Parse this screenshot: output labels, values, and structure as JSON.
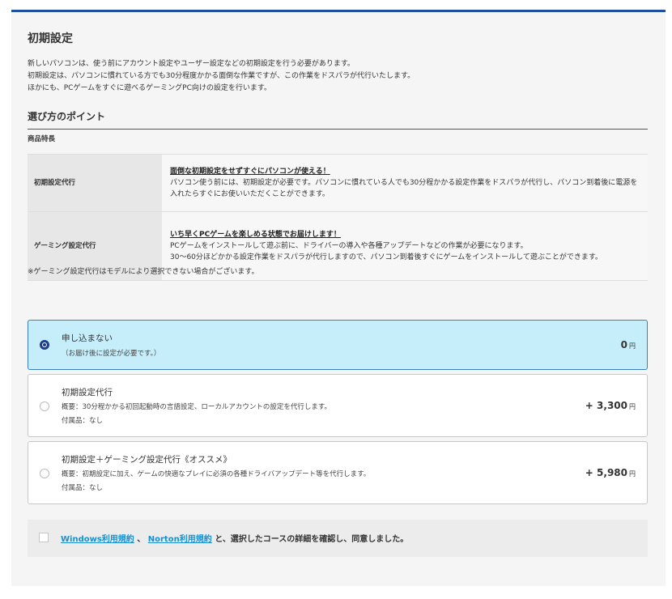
{
  "section": {
    "title": "初期設定",
    "intro": [
      "新しいパソコンは、使う前にアカウント設定やユーザー設定などの初期設定を行う必要があります。",
      "初期設定は、パソコンに慣れている方でも30分程度かかる面倒な作業ですが、この作業をドスパラが代行いたします。",
      "ほかにも、PCゲームをすぐに遊べるゲーミングPC向けの設定を行います。"
    ]
  },
  "points": {
    "heading": "選び方のポイント",
    "features_label": "商品特長",
    "rows": [
      {
        "label": "初期設定代行",
        "headline": "面倒な初期設定をせずすぐにパソコンが使える！",
        "body": "パソコン使う前には、初期設定が必要です。パソコンに慣れている人でも30分程かかる設定作業をドスパラが代行し、パソコン到着後に電源を入れたらすぐにお使いいただくことができます。"
      },
      {
        "label": "ゲーミング設定代行",
        "headline": "いち早くPCゲームを楽しめる状態でお届けします！",
        "body1": "PCゲームをインストールして遊ぶ前に、ドライバーの導入や各種アップデートなどの作業が必要になります。",
        "body2": "30～60分ほどかかる設定作業をドスパラが代行しますので、パソコン到着後すぐにゲームをインストールして遊ぶことができます。"
      }
    ],
    "note": "※ゲーミング設定代行はモデルにより選択できない場合がございます。"
  },
  "options": [
    {
      "title": "申し込まない",
      "desc": "（お届け後に設定が必要です。）",
      "price": "0",
      "unit": "円",
      "selected": true
    },
    {
      "title": "初期設定代行",
      "desc": "概要：30分程かかる初回起動時の言語設定、ローカルアカウントの設定を代行します。",
      "accessory": "付属品：なし",
      "price": "+ 3,300",
      "unit": "円",
      "selected": false
    },
    {
      "title": "初期設定＋ゲーミング設定代行《オススメ》",
      "desc": "概要：初期設定に加え、ゲームの快適なプレイに必須の各種ドライバアップデート等を代行します。",
      "accessory": "付属品：なし",
      "price": "+ 5,980",
      "unit": "円",
      "selected": false
    }
  ],
  "agreement": {
    "link1": "Windows利用規約",
    "separator": "、",
    "link2": "Norton利用規約",
    "suffix": "と、選択したコースの詳細を確認し、同意しました。",
    "checked": false
  },
  "colors": {
    "accent_bar": "#1e4fa0",
    "selected_bg": "#c5eefa",
    "radio": "#1e3f8a",
    "link": "#1a8fd0"
  }
}
